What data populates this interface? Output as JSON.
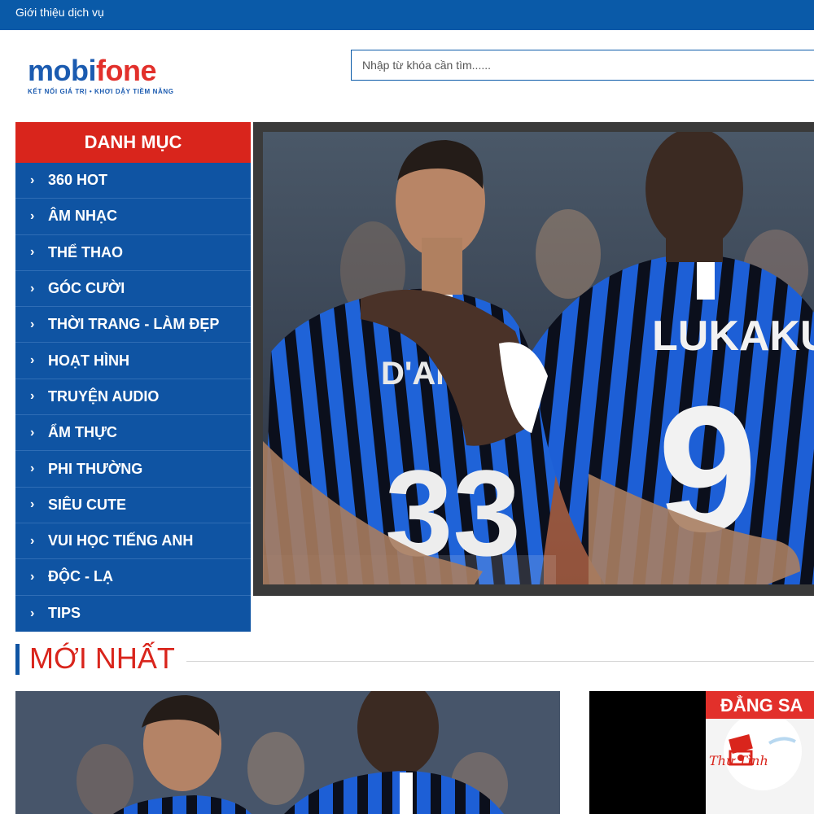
{
  "topbar": {
    "link": "Giới thiệu dịch vụ"
  },
  "logo": {
    "word_part1": "mobi",
    "word_part2": "fone",
    "tagline": "KẾT NỐI GIÁ TRỊ  •  KHƠI DẬY TIỀM NĂNG"
  },
  "search": {
    "placeholder": "Nhập từ khóa cần tìm......"
  },
  "categories": {
    "title": "DANH MỤC",
    "items": [
      {
        "label": "360 HOT"
      },
      {
        "label": "ÂM NHẠC"
      },
      {
        "label": "THỂ THAO"
      },
      {
        "label": "GÓC CƯỜI"
      },
      {
        "label": "THỜI TRANG - LÀM ĐẸP"
      },
      {
        "label": "HOẠT HÌNH"
      },
      {
        "label": "TRUYỆN AUDIO"
      },
      {
        "label": "ẨM THỰC"
      },
      {
        "label": "PHI THƯỜNG"
      },
      {
        "label": "SIÊU CUTE"
      },
      {
        "label": "VUI HỌC TIẾNG ANH"
      },
      {
        "label": "ĐỘC - LẠ"
      },
      {
        "label": "TIPS"
      }
    ]
  },
  "video": {
    "jersey_name_right": "LUKAKU",
    "jersey_number_right": "9",
    "jersey_name_left": "D'AMBROSIO",
    "jersey_number_left": "33"
  },
  "latest": {
    "title": "MỚI NHẤT",
    "small_thumb_banner": "ĐẲNG SA",
    "small_thumb_brand": "Thư Tình"
  },
  "colors": {
    "primary_blue": "#0f54a3",
    "accent_red": "#d9251c",
    "topbar_blue": "#0a5aa8"
  }
}
